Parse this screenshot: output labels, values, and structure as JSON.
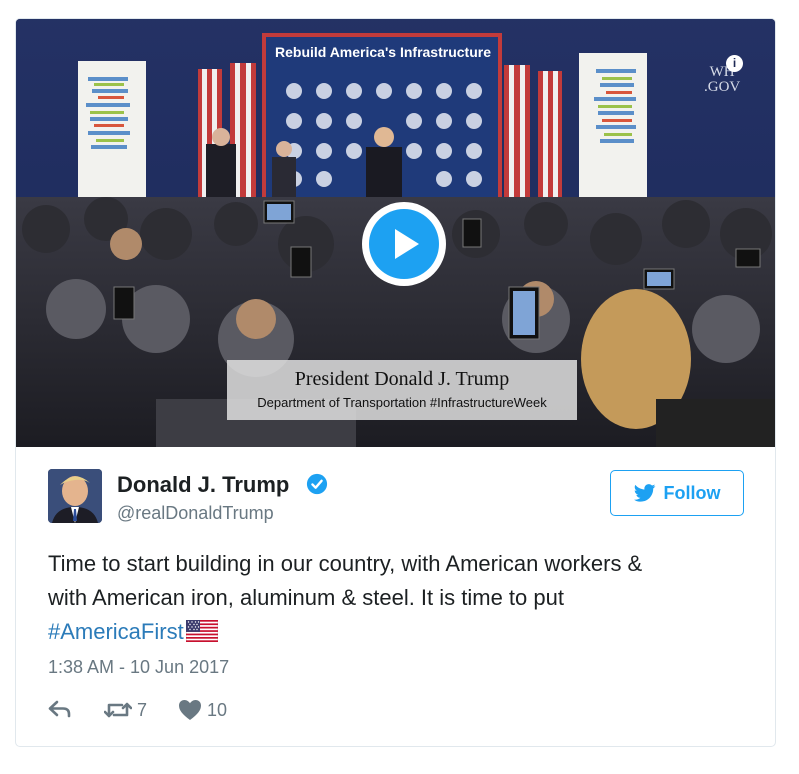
{
  "media": {
    "banner_title": "Rebuild America's Infrastructure",
    "wh_logo_line1": "WH",
    "wh_logo_line2": ".GOV",
    "lower_third_name": "President Donald J. Trump",
    "lower_third_subtitle": "Department of Transportation #InfrastructureWeek",
    "info_glyph": "i",
    "play_icon": "play-icon"
  },
  "author": {
    "display_name": "Donald J. Trump",
    "handle": "@realDonaldTrump",
    "verified_icon": "verified-badge-icon"
  },
  "follow_button": {
    "label": "Follow",
    "icon": "twitter-bird-icon"
  },
  "tweet": {
    "text_line1": "Time to start building in our country, with American workers &",
    "text_line2": "with American iron, aluminum & steel. It is time to put",
    "hashtag": "#AmericaFirst",
    "flag_emoji": "us-flag-icon",
    "timestamp": "1:38 AM - 10 Jun 2017"
  },
  "actions": {
    "reply_icon": "reply-icon",
    "retweet_icon": "retweet-icon",
    "retweet_count": "7",
    "like_icon": "heart-icon",
    "like_count": "10"
  },
  "colors": {
    "twitter_blue": "#1da1f2",
    "hashtag_blue": "#2b7bb9",
    "muted_gray": "#697882",
    "text_dark": "#1c2022",
    "border": "#e1e8ed"
  }
}
